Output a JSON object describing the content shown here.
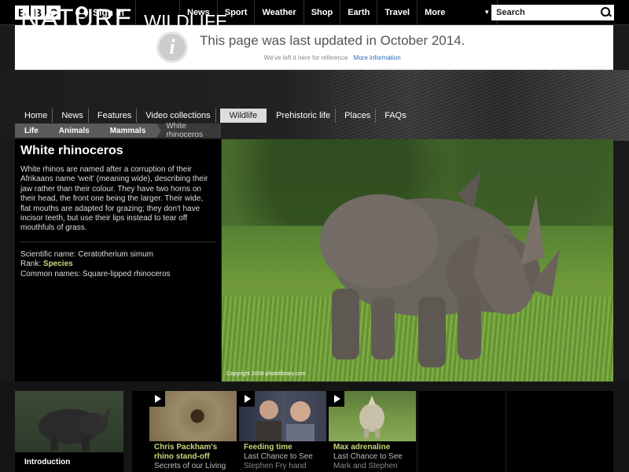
{
  "bbc": {
    "logo_letters": [
      "B",
      "B",
      "C"
    ],
    "signin_label": "Sign in",
    "nav": [
      "News",
      "Sport",
      "Weather",
      "Shop",
      "Earth",
      "Travel"
    ],
    "more_label": "More",
    "search_placeholder": "Search"
  },
  "notice": {
    "icon": "info-icon",
    "title": "This page was last updated in October 2014.",
    "subtitle": "We've left it here for reference",
    "link": "More information"
  },
  "site": {
    "title": "NATURE",
    "section": "WILDLIFE"
  },
  "section_nav": [
    {
      "label": "Home",
      "active": false
    },
    {
      "label": "News",
      "active": false
    },
    {
      "label": "Features",
      "active": false
    },
    {
      "label": "Video collections",
      "active": false
    },
    {
      "label": "Wildlife",
      "active": true
    },
    {
      "label": "Prehistoric life",
      "active": false
    },
    {
      "label": "Places",
      "active": false
    },
    {
      "label": "FAQs",
      "active": false
    }
  ],
  "breadcrumb": [
    "Life",
    "Animals",
    "Mammals",
    "White rhinoceros"
  ],
  "species": {
    "title": "White rhinoceros",
    "description": "White rhinos are named after a corruption of their Afrikaans name 'weit' (meaning wide), describing their jaw rather than their colour. They have two horns on their head, the front one being the larger. Their wide, flat mouths are adapted for grazing; they don't have incisor teeth, but use their lips instead to tear off mouthfuls of grass.",
    "scientific_name_label": "Scientific name:",
    "scientific_name": "Ceratotherium simum",
    "rank_label": "Rank:",
    "rank": "Species",
    "common_names_label": "Common names:",
    "common_names": "Square-lipped rhinoceros"
  },
  "image": {
    "credit": "Copyright 2009 photolibrary.com"
  },
  "intro": {
    "label": "Introduction"
  },
  "videos": [
    {
      "title": "Chris Packham's rhino stand-off",
      "sub": "Secrets of our Living"
    },
    {
      "title": "Feeding time",
      "sub": "Last Chance to See",
      "sub2": "Stephen Fry hand"
    },
    {
      "title": "Max adrenaline",
      "sub": "Last Chance to See",
      "sub2": "Mark and Stephen"
    }
  ],
  "colors": {
    "accent_link": "#c9d77a",
    "notice_link": "#2a6db6"
  }
}
